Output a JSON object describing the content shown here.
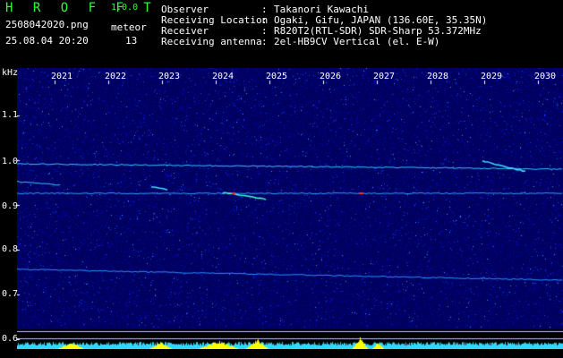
{
  "app": {
    "name": "H R O F F T",
    "version": "1.0.0",
    "filename": "2508042020.png",
    "datetime": "25.08.04 20:20",
    "meteor_label": "meteor",
    "meteor_count": "13"
  },
  "info": [
    {
      "key": "Observer",
      "sep": ":",
      "value": "Takanori Kawachi"
    },
    {
      "key": "Receiving Location",
      "sep": ":",
      "value": "Ogaki, Gifu, JAPAN (136.60E, 35.35N)"
    },
    {
      "key": "Receiver",
      "sep": ":",
      "value": "R820T2(RTL-SDR) SDR-Sharp 53.372MHz"
    },
    {
      "key": "Receiving antenna",
      "sep": ":",
      "value": "2el-HB9CV Vertical (el. E-W)"
    }
  ],
  "axis": {
    "y_unit": "kHz",
    "y_ticks": [
      "1.1",
      "1.0",
      "0.9",
      "0.8",
      "0.7",
      "0.6"
    ],
    "x_ticks": [
      "2021",
      "2022",
      "2023",
      "2024",
      "2025",
      "2026",
      "2027",
      "2028",
      "2029",
      "2030"
    ]
  },
  "colors": {
    "background": "#000000",
    "spectrum_base": "#00007a",
    "trace": "#30c8ff",
    "meteor": "#ff3030",
    "level_bar": "#30d8ff",
    "level_peak": "#ffff00",
    "label_green": "#33ff33",
    "text": "#ffffff"
  }
}
